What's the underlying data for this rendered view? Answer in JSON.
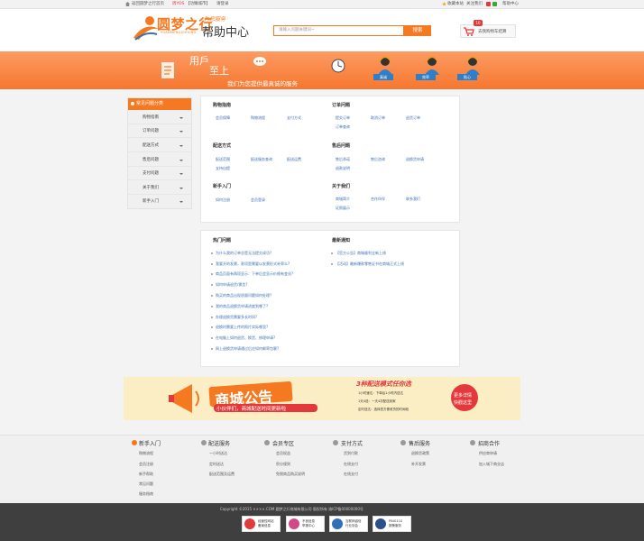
{
  "topbar": {
    "home": "返回圆梦之行首页",
    "promo_1": "周YOS",
    "promo_2": "【功臻城市】",
    "login": "请登录",
    "right_links": [
      "收藏本站",
      "关注我们",
      "帮助中心"
    ]
  },
  "header": {
    "logo_main": "圆梦之行",
    "logo_sub": "YUANMENGZHIXING",
    "logo_tag": "为您服务",
    "help_title": "帮助中心",
    "search_placeholder": "请输入问题关键词~",
    "search_button": "搜索",
    "cart_label": "去我购物车结算",
    "cart_count": "10"
  },
  "banner": {
    "line1": "用戶",
    "line2": "至上",
    "line3": "我们为您提供最真诚的服务",
    "labels": [
      "真诚",
      "效率",
      "贴心"
    ]
  },
  "sidebar": {
    "heading": "常见问题分类",
    "items": [
      "购物指南",
      "订单问题",
      "配送方式",
      "售后问题",
      "支付问题",
      "关于我们",
      "新手入门"
    ]
  },
  "categories": [
    {
      "title": "购物指南",
      "links": [
        "会员保障",
        "购物流程",
        "支付方式"
      ]
    },
    {
      "title": "订单问题",
      "links": [
        "提交订单",
        "取消订单",
        "退货订单",
        "订单查询"
      ]
    },
    {
      "title": "配送方式",
      "links": [
        "配送范围",
        "配送服务查询",
        "配送运费",
        "支持自提"
      ]
    },
    {
      "title": "售后问题",
      "links": [
        "售后承诺",
        "售后咨询",
        "退换货申请",
        "退款说明"
      ]
    },
    {
      "title": "新手入门",
      "links": [
        "如何注册",
        "会员登录"
      ]
    },
    {
      "title": "关于我们",
      "links": [
        "商城简介",
        "合作伙伴",
        "联系我们",
        "证照展示"
      ]
    }
  ],
  "hot": {
    "title": "热门问题",
    "items": [
      "为什么我的订单总是无法提交成功?",
      "我要开的发票，款项是需要以发票形式补寄么?",
      "商品页面有两项显示：下单后会显示价格有变化?",
      "如何申请退货/换货?",
      "购买的商品出现质量问题如何处理?",
      "我的商品退换货申请进度到哪了?",
      "办理退换货需要多长时间?",
      "退换时需要上传的照片实际哪里?",
      "在电脑上如何退货、换货、修理申请?",
      "网上退换货申请通过后应如何邮寄包裹?"
    ]
  },
  "news": {
    "title": "最新通知",
    "items": [
      "【官方公告】商城顺利全新上线",
      "【活动】最新爆款零售证书在商城正式上线"
    ]
  },
  "ad": {
    "title": "商城公告",
    "subtitle": "小伙伴们，商城配送时间更新啦",
    "promo_title": "3种配送模式任你选",
    "promo_lines": [
      "1小时速达：下单后1小时内送达",
      "1天4送：一天4次配送到家",
      "定时送达：选择您方便收货的时间段"
    ],
    "cta_1": "更多详情",
    "cta_2": "快戳这里"
  },
  "footer": {
    "columns": [
      {
        "title": "新手入门",
        "links": [
          "购物流程",
          "会员注册",
          "新手帮助",
          "常见问题",
          "服务指南"
        ]
      },
      {
        "title": "配送服务",
        "links": [
          "一小时送达",
          "定时送达",
          "配送范围及运费"
        ]
      },
      {
        "title": "会员专区",
        "links": [
          "会员权益",
          "积分规则",
          "免税商品购买说明"
        ]
      },
      {
        "title": "支付方式",
        "links": [
          "货到付款",
          "在线支付",
          "在线支付"
        ]
      },
      {
        "title": "售后服务",
        "links": [
          "退换货政策",
          "补开发票"
        ]
      },
      {
        "title": "招商合作",
        "links": [
          "供应商申请",
          "加入城下商业店"
        ]
      }
    ],
    "copyright": "Copyright ©2015 ××××.COM 圆梦之行商城有限公司 版权所有 渝ICP备00000000号",
    "badges": [
      {
        "l1": "经营性网站",
        "l2": "备案信息"
      },
      {
        "l1": "不良信息",
        "l2": "举报中心"
      },
      {
        "l1": "互联网诚信",
        "l2": "行业协会"
      },
      {
        "l1": "PING110",
        "l2": "报警服务"
      }
    ]
  }
}
